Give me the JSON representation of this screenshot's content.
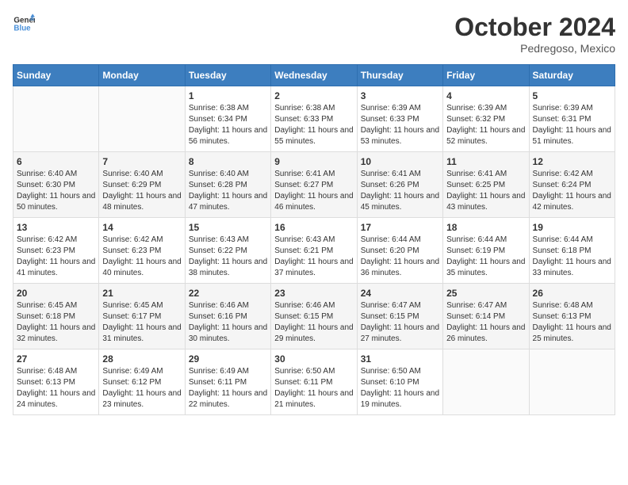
{
  "header": {
    "logo_line1": "General",
    "logo_line2": "Blue",
    "month": "October 2024",
    "location": "Pedregoso, Mexico"
  },
  "days_of_week": [
    "Sunday",
    "Monday",
    "Tuesday",
    "Wednesday",
    "Thursday",
    "Friday",
    "Saturday"
  ],
  "weeks": [
    [
      {
        "day": "",
        "info": ""
      },
      {
        "day": "",
        "info": ""
      },
      {
        "day": "1",
        "info": "Sunrise: 6:38 AM\nSunset: 6:34 PM\nDaylight: 11 hours and 56 minutes."
      },
      {
        "day": "2",
        "info": "Sunrise: 6:38 AM\nSunset: 6:33 PM\nDaylight: 11 hours and 55 minutes."
      },
      {
        "day": "3",
        "info": "Sunrise: 6:39 AM\nSunset: 6:33 PM\nDaylight: 11 hours and 53 minutes."
      },
      {
        "day": "4",
        "info": "Sunrise: 6:39 AM\nSunset: 6:32 PM\nDaylight: 11 hours and 52 minutes."
      },
      {
        "day": "5",
        "info": "Sunrise: 6:39 AM\nSunset: 6:31 PM\nDaylight: 11 hours and 51 minutes."
      }
    ],
    [
      {
        "day": "6",
        "info": "Sunrise: 6:40 AM\nSunset: 6:30 PM\nDaylight: 11 hours and 50 minutes."
      },
      {
        "day": "7",
        "info": "Sunrise: 6:40 AM\nSunset: 6:29 PM\nDaylight: 11 hours and 48 minutes."
      },
      {
        "day": "8",
        "info": "Sunrise: 6:40 AM\nSunset: 6:28 PM\nDaylight: 11 hours and 47 minutes."
      },
      {
        "day": "9",
        "info": "Sunrise: 6:41 AM\nSunset: 6:27 PM\nDaylight: 11 hours and 46 minutes."
      },
      {
        "day": "10",
        "info": "Sunrise: 6:41 AM\nSunset: 6:26 PM\nDaylight: 11 hours and 45 minutes."
      },
      {
        "day": "11",
        "info": "Sunrise: 6:41 AM\nSunset: 6:25 PM\nDaylight: 11 hours and 43 minutes."
      },
      {
        "day": "12",
        "info": "Sunrise: 6:42 AM\nSunset: 6:24 PM\nDaylight: 11 hours and 42 minutes."
      }
    ],
    [
      {
        "day": "13",
        "info": "Sunrise: 6:42 AM\nSunset: 6:23 PM\nDaylight: 11 hours and 41 minutes."
      },
      {
        "day": "14",
        "info": "Sunrise: 6:42 AM\nSunset: 6:23 PM\nDaylight: 11 hours and 40 minutes."
      },
      {
        "day": "15",
        "info": "Sunrise: 6:43 AM\nSunset: 6:22 PM\nDaylight: 11 hours and 38 minutes."
      },
      {
        "day": "16",
        "info": "Sunrise: 6:43 AM\nSunset: 6:21 PM\nDaylight: 11 hours and 37 minutes."
      },
      {
        "day": "17",
        "info": "Sunrise: 6:44 AM\nSunset: 6:20 PM\nDaylight: 11 hours and 36 minutes."
      },
      {
        "day": "18",
        "info": "Sunrise: 6:44 AM\nSunset: 6:19 PM\nDaylight: 11 hours and 35 minutes."
      },
      {
        "day": "19",
        "info": "Sunrise: 6:44 AM\nSunset: 6:18 PM\nDaylight: 11 hours and 33 minutes."
      }
    ],
    [
      {
        "day": "20",
        "info": "Sunrise: 6:45 AM\nSunset: 6:18 PM\nDaylight: 11 hours and 32 minutes."
      },
      {
        "day": "21",
        "info": "Sunrise: 6:45 AM\nSunset: 6:17 PM\nDaylight: 11 hours and 31 minutes."
      },
      {
        "day": "22",
        "info": "Sunrise: 6:46 AM\nSunset: 6:16 PM\nDaylight: 11 hours and 30 minutes."
      },
      {
        "day": "23",
        "info": "Sunrise: 6:46 AM\nSunset: 6:15 PM\nDaylight: 11 hours and 29 minutes."
      },
      {
        "day": "24",
        "info": "Sunrise: 6:47 AM\nSunset: 6:15 PM\nDaylight: 11 hours and 27 minutes."
      },
      {
        "day": "25",
        "info": "Sunrise: 6:47 AM\nSunset: 6:14 PM\nDaylight: 11 hours and 26 minutes."
      },
      {
        "day": "26",
        "info": "Sunrise: 6:48 AM\nSunset: 6:13 PM\nDaylight: 11 hours and 25 minutes."
      }
    ],
    [
      {
        "day": "27",
        "info": "Sunrise: 6:48 AM\nSunset: 6:13 PM\nDaylight: 11 hours and 24 minutes."
      },
      {
        "day": "28",
        "info": "Sunrise: 6:49 AM\nSunset: 6:12 PM\nDaylight: 11 hours and 23 minutes."
      },
      {
        "day": "29",
        "info": "Sunrise: 6:49 AM\nSunset: 6:11 PM\nDaylight: 11 hours and 22 minutes."
      },
      {
        "day": "30",
        "info": "Sunrise: 6:50 AM\nSunset: 6:11 PM\nDaylight: 11 hours and 21 minutes."
      },
      {
        "day": "31",
        "info": "Sunrise: 6:50 AM\nSunset: 6:10 PM\nDaylight: 11 hours and 19 minutes."
      },
      {
        "day": "",
        "info": ""
      },
      {
        "day": "",
        "info": ""
      }
    ]
  ]
}
